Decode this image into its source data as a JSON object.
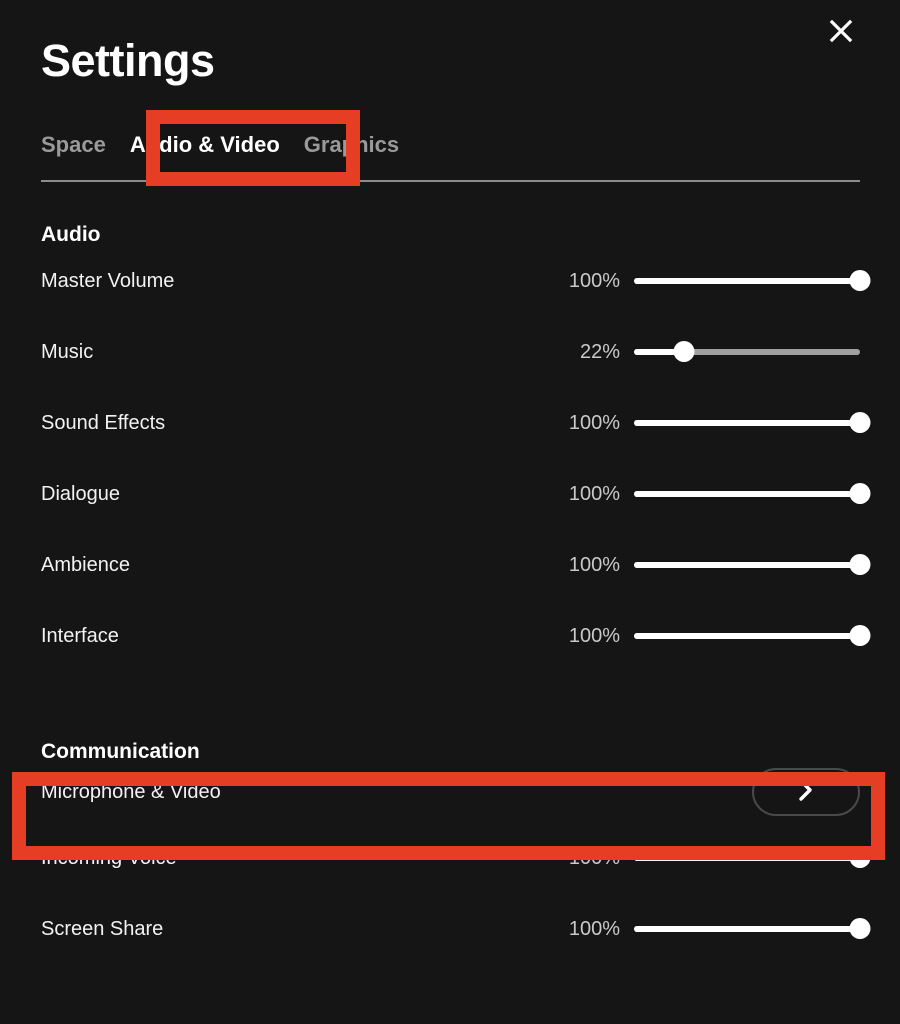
{
  "window": {
    "title": "Settings",
    "close_icon": "close-icon"
  },
  "tabs": [
    {
      "label": "Space",
      "active": false
    },
    {
      "label": "Audio & Video",
      "active": true
    },
    {
      "label": "Graphics",
      "active": false
    }
  ],
  "sections": [
    {
      "title": "Audio",
      "rows": [
        {
          "label": "Master Volume",
          "value": "100%",
          "percent": 100,
          "type": "slider"
        },
        {
          "label": "Music",
          "value": "22%",
          "percent": 22,
          "type": "slider"
        },
        {
          "label": "Sound Effects",
          "value": "100%",
          "percent": 100,
          "type": "slider"
        },
        {
          "label": "Dialogue",
          "value": "100%",
          "percent": 100,
          "type": "slider"
        },
        {
          "label": "Ambience",
          "value": "100%",
          "percent": 100,
          "type": "slider"
        },
        {
          "label": "Interface",
          "value": "100%",
          "percent": 100,
          "type": "slider"
        }
      ]
    },
    {
      "title": "Communication",
      "rows": [
        {
          "label": "Microphone & Video",
          "type": "nav",
          "chevron_icon": "chevron-right-icon"
        },
        {
          "label": "Incoming Voice",
          "value": "100%",
          "percent": 100,
          "type": "slider"
        },
        {
          "label": "Screen Share",
          "value": "100%",
          "percent": 100,
          "type": "slider"
        }
      ]
    }
  ],
  "annotations": [
    {
      "name": "audio-video-tab-highlight",
      "color": "#e63e24"
    },
    {
      "name": "microphone-video-row-highlight",
      "color": "#e63e24"
    }
  ],
  "colors": {
    "background": "#151515",
    "accent_highlight": "#e63e24",
    "slider_fill": "#ffffff",
    "slider_track": "#a0a0a0",
    "inactive_tab": "#9a9a9a",
    "divider": "#8c8c8c"
  }
}
